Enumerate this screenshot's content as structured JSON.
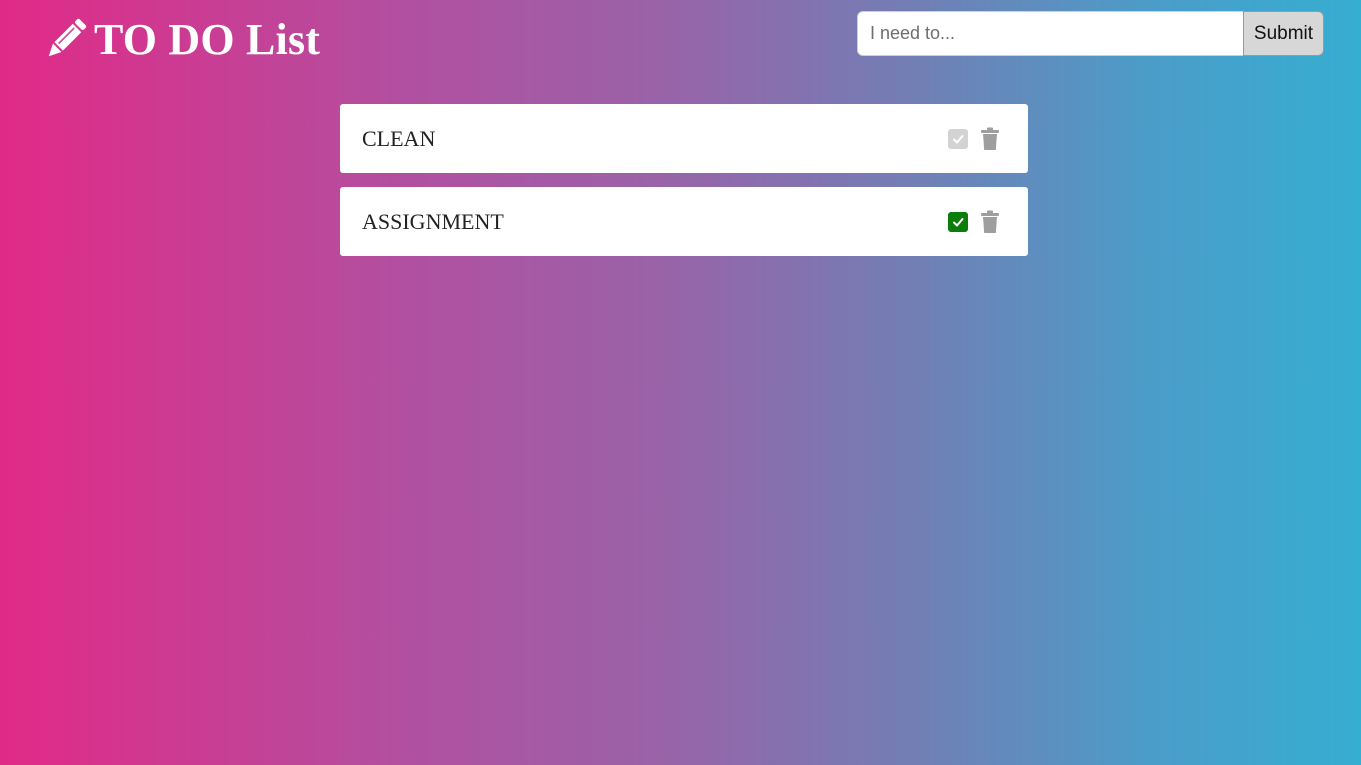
{
  "header": {
    "title": "TO DO List",
    "icon": "pencil-icon"
  },
  "form": {
    "placeholder": "I need to...",
    "value": "",
    "submit_label": "Submit"
  },
  "tasks": [
    {
      "text": "CLEAN",
      "completed": false,
      "check_color": "#d3d3d3"
    },
    {
      "text": "ASSIGNMENT",
      "completed": true,
      "check_color": "#0a7d0a"
    }
  ],
  "colors": {
    "gradient_start": "#e12a87",
    "gradient_end": "#36aed1",
    "trash": "#9e9e9e"
  }
}
